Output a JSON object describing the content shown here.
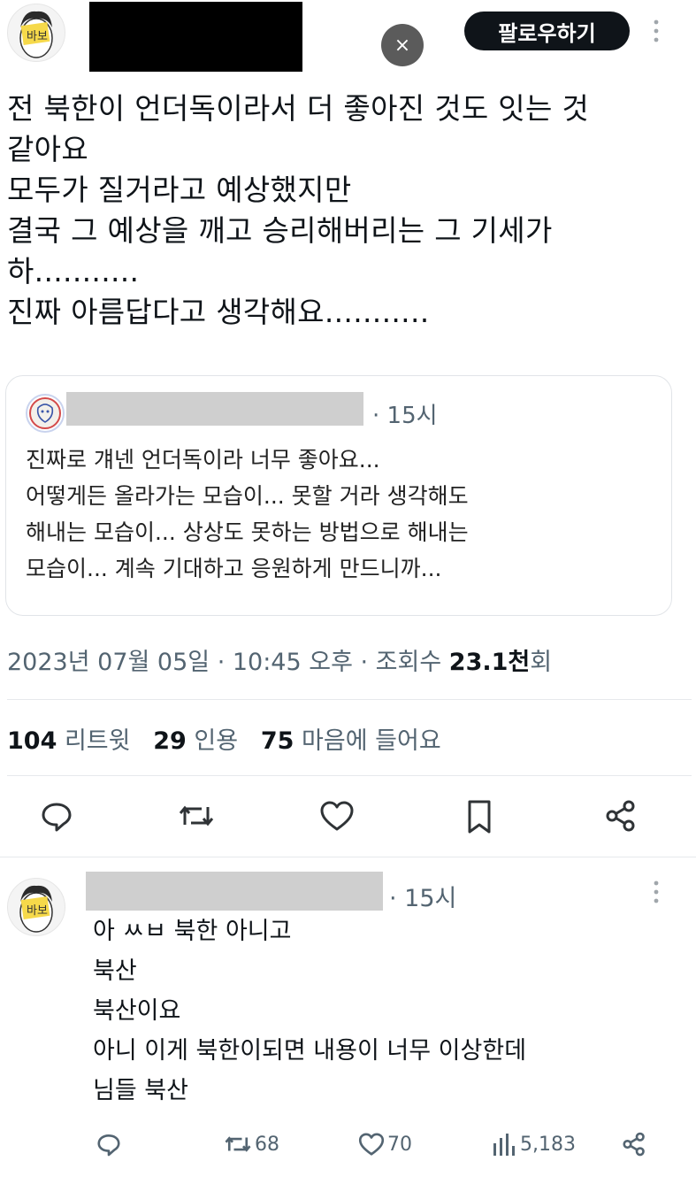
{
  "main_tweet": {
    "avatar_label": "바보",
    "follow_label": "팔로우하기",
    "close_symbol": "×",
    "body_lines": [
      "전 북한이 언더독이라서 더 좋아진 것도 잇는 것",
      "같아요",
      "모두가 질거라고 예상했지만",
      "결국 그 예상을 깨고 승리해버리는 그 기세가",
      "하...........",
      "진짜 아름답다고 생각해요..........."
    ],
    "quote": {
      "time": "· 15시",
      "lines": [
        "진짜로 걔넨 언더독이라 너무 좋아요...",
        "어떻게든 올라가는 모습이... 못할 거라 생각해도",
        "해내는 모습이... 상상도 못하는 방법으로 해내는",
        "모습이... 계속 기대하고 응원하게 만드니까..."
      ]
    },
    "meta": {
      "date": "2023년 07월 05일 · 10:45 오후 · 조회수 ",
      "views": "23.1천",
      "views_suffix": "회"
    },
    "stats": {
      "retweets_count": "104",
      "retweets_label": "리트윗",
      "quotes_count": "29",
      "quotes_label": "인용",
      "likes_count": "75",
      "likes_label": "마음에 들어요"
    }
  },
  "reply": {
    "avatar_label": "바보",
    "time": "· 15시",
    "lines": [
      "아 ㅆㅂ 북한 아니고",
      "북산",
      "북산이요",
      "아니 이게 북한이되면 내용이 너무 이상한데",
      "님들 북산"
    ],
    "retweets": "68",
    "likes": "70",
    "views": "5,183"
  },
  "colors": {
    "text": "#0f1419",
    "secondary": "#536471",
    "follow_bg": "#0f1419",
    "redaction_black": "#000000",
    "redaction_gray": "#cfcfcf"
  }
}
